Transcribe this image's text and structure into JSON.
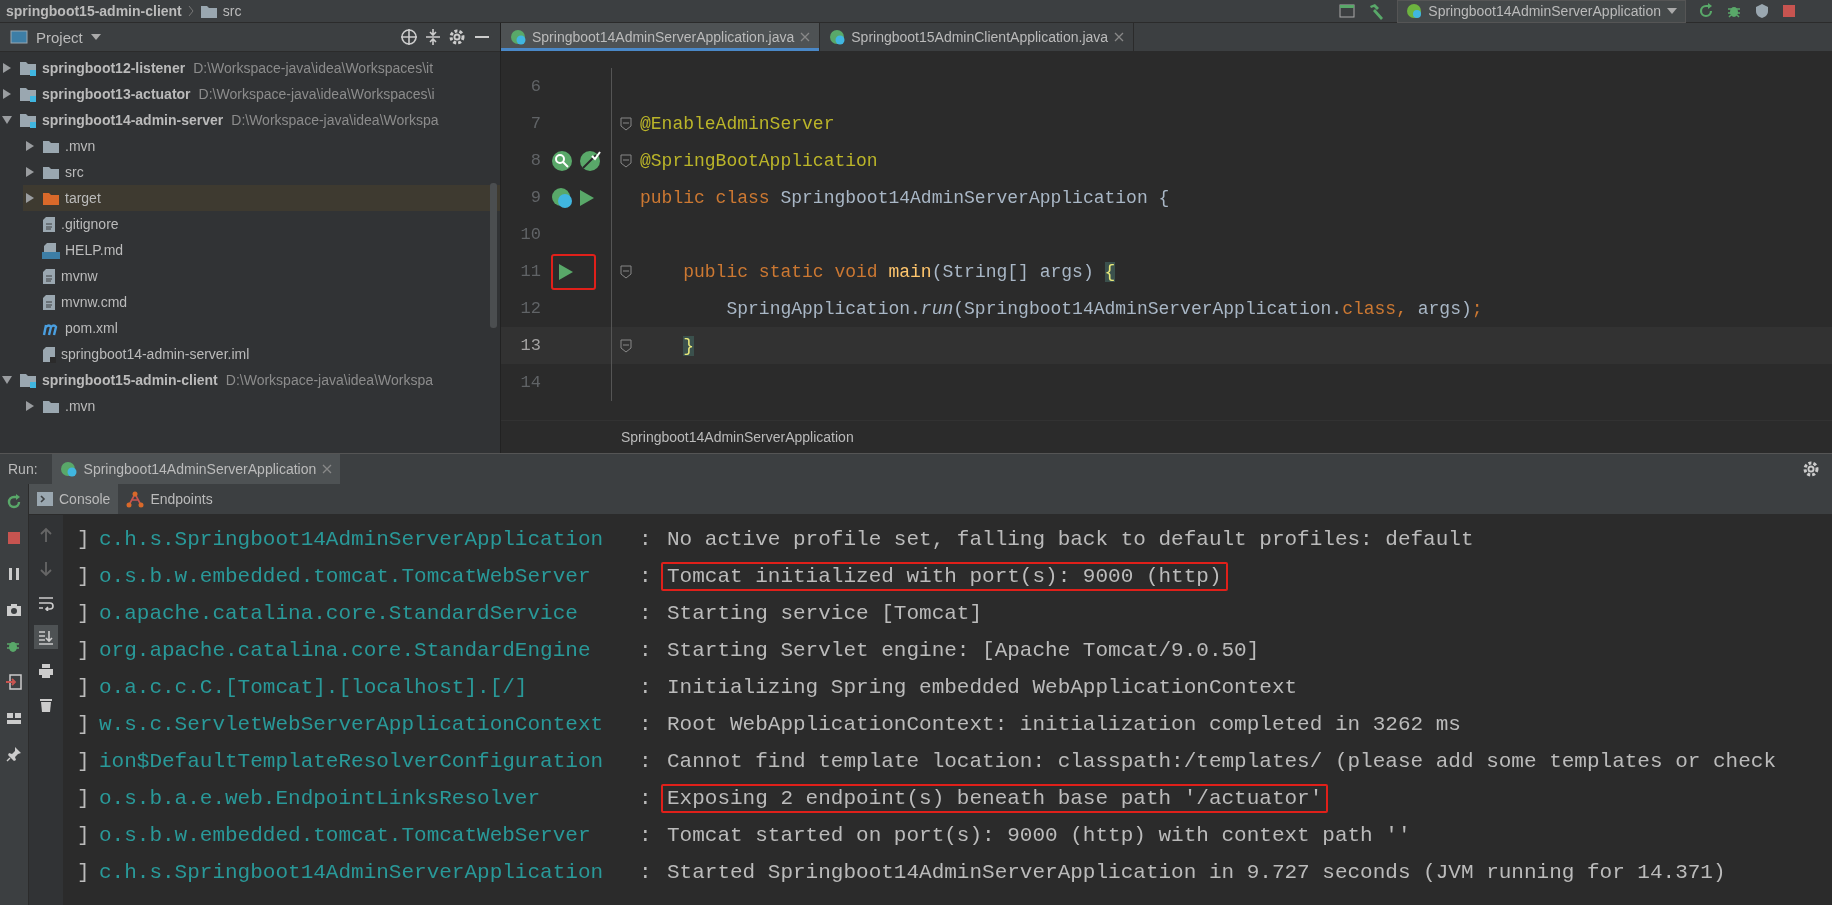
{
  "navbar": {
    "crumbs": [
      {
        "label": "springboot15-admin-client",
        "kind": "module"
      },
      {
        "label": "src",
        "kind": "folder"
      }
    ],
    "run_config": "Springboot14AdminServerApplication"
  },
  "project": {
    "title": "Project",
    "tree": [
      {
        "label": "springboot12-listener",
        "path": "D:\\Workspace-java\\idea\\Workspaces\\it",
        "kind": "module",
        "expanded": false,
        "selected": false
      },
      {
        "label": "springboot13-actuator",
        "path": "D:\\Workspace-java\\idea\\Workspaces\\i",
        "kind": "module",
        "expanded": false,
        "selected": false
      },
      {
        "label": "springboot14-admin-server",
        "path": "D:\\Workspace-java\\idea\\Workspa",
        "kind": "module",
        "expanded": true,
        "selected": false,
        "children": [
          {
            "label": ".mvn",
            "kind": "folder",
            "expanded": false,
            "selected": false
          },
          {
            "label": "src",
            "kind": "folder",
            "expanded": false,
            "selected": false
          },
          {
            "label": "target",
            "kind": "excluded",
            "expanded": false,
            "selected": true
          },
          {
            "label": ".gitignore",
            "kind": "file",
            "selected": false
          },
          {
            "label": "HELP.md",
            "kind": "markdown",
            "selected": false
          },
          {
            "label": "mvnw",
            "kind": "file",
            "selected": false
          },
          {
            "label": "mvnw.cmd",
            "kind": "file",
            "selected": false
          },
          {
            "label": "pom.xml",
            "kind": "pom",
            "selected": false
          },
          {
            "label": "springboot14-admin-server.iml",
            "kind": "iml",
            "selected": false
          }
        ]
      },
      {
        "label": "springboot15-admin-client",
        "path": "D:\\Workspace-java\\idea\\Workspa",
        "kind": "module",
        "expanded": true,
        "selected": false,
        "children": [
          {
            "label": ".mvn",
            "kind": "folder",
            "expanded": false,
            "selected": false
          }
        ]
      }
    ]
  },
  "editor": {
    "tabs": [
      {
        "label": "Springboot14AdminServerApplication.java",
        "selected": true
      },
      {
        "label": "Springboot15AdminClientApplication.java",
        "selected": false
      }
    ],
    "lines": [
      {
        "number": "6",
        "current": false
      },
      {
        "number": "7",
        "current": false,
        "fold": true,
        "tokens": [
          {
            "text": "@EnableAdminServer",
            "kind": "annotation"
          }
        ]
      },
      {
        "number": "8",
        "current": false,
        "fold": true,
        "gutter": [
          {
            "kind": "search"
          },
          {
            "kind": "spring"
          }
        ],
        "tokens": [
          {
            "text": "@SpringBootApplication",
            "kind": "annotation"
          }
        ]
      },
      {
        "number": "9",
        "current": false,
        "gutter": [
          {
            "kind": "class"
          },
          {
            "kind": "run"
          }
        ],
        "tokens": [
          {
            "text": "public class ",
            "kind": "keyword"
          },
          {
            "text": "Springboot14AdminServerApplication {",
            "kind": "plain"
          }
        ]
      },
      {
        "number": "10",
        "current": false
      },
      {
        "number": "11",
        "current": false,
        "fold": true,
        "gutter": [
          {
            "kind": "run"
          }
        ],
        "highlighted": true,
        "tokens": [
          {
            "text": "    public static void ",
            "kind": "keyword"
          },
          {
            "text": "main",
            "kind": "method"
          },
          {
            "text": "(String[] args) ",
            "kind": "plain"
          },
          {
            "text": "{",
            "kind": "brace"
          }
        ]
      },
      {
        "number": "12",
        "current": false,
        "tokens": [
          {
            "text": "        SpringApplication.",
            "kind": "plain"
          },
          {
            "text": "run",
            "kind": "italic"
          },
          {
            "text": "(Springboot14AdminServerApplication.",
            "kind": "plain"
          },
          {
            "text": "class",
            "kind": "keyword"
          },
          {
            "text": ", ",
            "kind": "keyword"
          },
          {
            "text": "args)",
            "kind": "plain"
          },
          {
            "text": ";",
            "kind": "keyword"
          }
        ]
      },
      {
        "number": "13",
        "current": true,
        "fold": true,
        "tokens": [
          {
            "text": "    }",
            "kind": "brace"
          }
        ]
      },
      {
        "number": "14",
        "current": false
      }
    ],
    "breadcrumb": "Springboot14AdminServerApplication"
  },
  "run": {
    "label": "Run:",
    "tab": "Springboot14AdminServerApplication",
    "subtabs": [
      {
        "label": "Console",
        "kind": "console",
        "selected": true
      },
      {
        "label": "Endpoints",
        "kind": "endpoints",
        "selected": false
      }
    ],
    "lines": [
      {
        "bracket": "]",
        "logger": "c.h.s.Springboot14AdminServerApplication",
        "separator": ":",
        "message": "No active profile set, falling back to default profiles: default",
        "highlighted": false
      },
      {
        "bracket": "]",
        "logger": "o.s.b.w.embedded.tomcat.TomcatWebServer",
        "separator": ":",
        "message": "Tomcat initialized with port(s): 9000 (http)",
        "highlighted": true
      },
      {
        "bracket": "]",
        "logger": "o.apache.catalina.core.StandardService",
        "separator": ":",
        "message": "Starting service [Tomcat]",
        "highlighted": false
      },
      {
        "bracket": "]",
        "logger": "org.apache.catalina.core.StandardEngine",
        "separator": ":",
        "message": "Starting Servlet engine: [Apache Tomcat/9.0.50]",
        "highlighted": false
      },
      {
        "bracket": "]",
        "logger": "o.a.c.c.C.[Tomcat].[localhost].[/]",
        "separator": ":",
        "message": "Initializing Spring embedded WebApplicationContext",
        "highlighted": false
      },
      {
        "bracket": "]",
        "logger": "w.s.c.ServletWebServerApplicationContext",
        "separator": ":",
        "message": "Root WebApplicationContext: initialization completed in 3262 ms",
        "highlighted": false
      },
      {
        "bracket": "]",
        "logger": "ion$DefaultTemplateResolverConfiguration",
        "separator": ":",
        "message": "Cannot find template location: classpath:/templates/ (please add some templates or check",
        "highlighted": false
      },
      {
        "bracket": "]",
        "logger": "o.s.b.a.e.web.EndpointLinksResolver",
        "separator": ":",
        "message": "Exposing 2 endpoint(s) beneath base path '/actuator'",
        "highlighted": true
      },
      {
        "bracket": "]",
        "logger": "o.s.b.w.embedded.tomcat.TomcatWebServer",
        "separator": ":",
        "message": "Tomcat started on port(s): 9000 (http) with context path ''",
        "highlighted": false
      },
      {
        "bracket": "]",
        "logger": "c.h.s.Springboot14AdminServerApplication",
        "separator": ":",
        "message": "Started Springboot14AdminServerApplication in 9.727 seconds (JVM running for 14.371)",
        "highlighted": false
      }
    ]
  }
}
